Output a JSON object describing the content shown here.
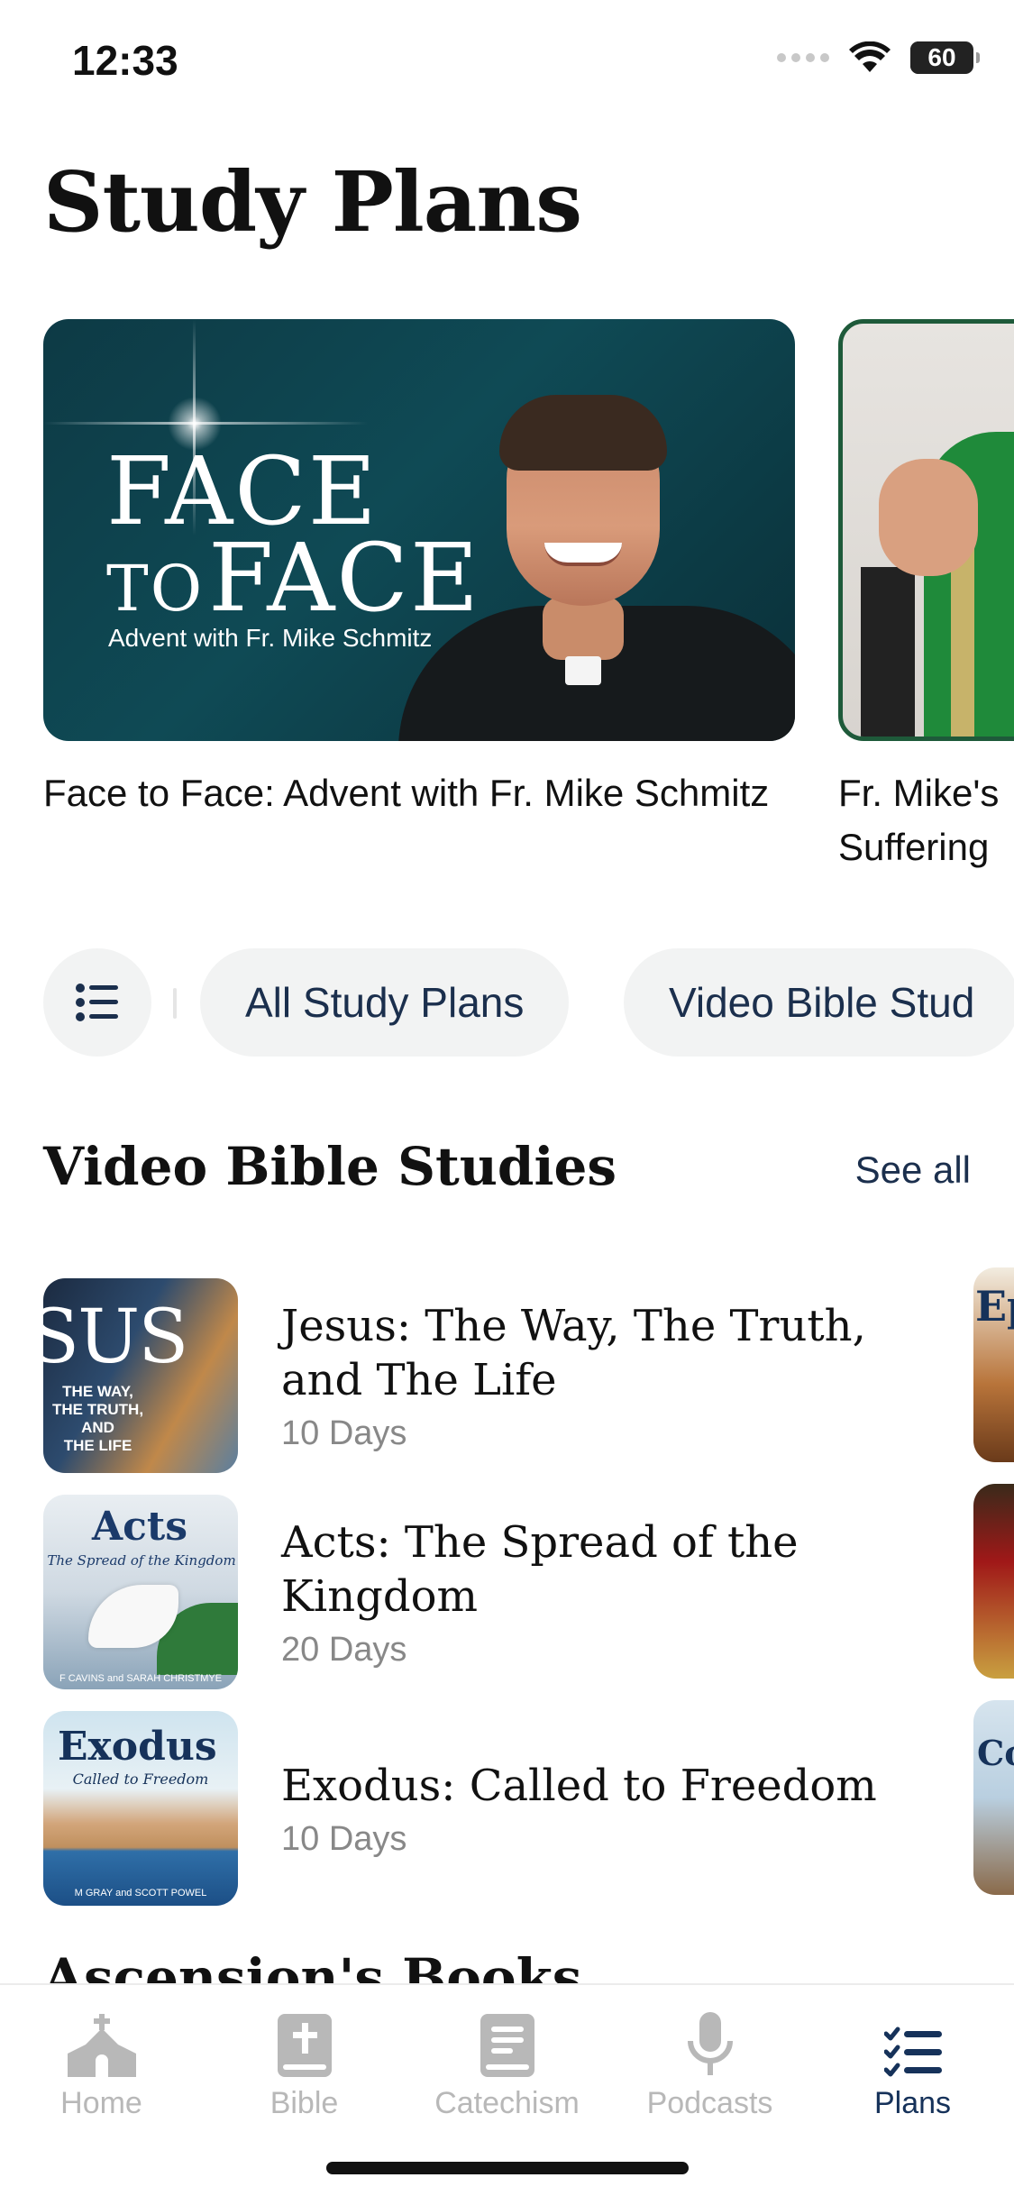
{
  "status_bar": {
    "time": "12:33",
    "battery_level": "60",
    "battery_fraction": 0.6
  },
  "header": {
    "title": "Study Plans"
  },
  "featured": [
    {
      "caption": "Face to Face: Advent with Fr. Mike Schmitz",
      "art_line1": "FACE",
      "art_to": "TO",
      "art_face": "FACE",
      "art_subtitle": "Advent with Fr. Mike Schmitz"
    },
    {
      "caption": "Fr. Mike's\nSuffering"
    }
  ],
  "filters": {
    "icon": "list-filter-icon",
    "pills": [
      "All Study Plans",
      "Video Bible Stud"
    ]
  },
  "section": {
    "title": "Video Bible Studies",
    "see_all": "See all",
    "items": [
      {
        "title": "Jesus: The Way, The Truth, and The Life",
        "days": "10 Days",
        "art_big": "SUS",
        "art_small": "THE WAY,\nTHE TRUTH,\nAND\nTHE LIFE"
      },
      {
        "title": "Acts: The Spread of the Kingdom",
        "days": "20 Days",
        "art_big": "Acts",
        "art_sub": "The Spread of the Kingdom",
        "art_authors": "F CAVINS and SARAH CHRISTMYE"
      },
      {
        "title": "Exodus: Called to Freedom",
        "days": "10 Days",
        "art_big": "Exodus",
        "art_sub": "Called to Freedom",
        "art_authors": "M GRAY and SCOTT POWEL"
      }
    ],
    "peek_labels": [
      "Ep",
      "",
      "Co"
    ]
  },
  "next_section": {
    "title": "Ascension's Books"
  },
  "tab_bar": {
    "tabs": [
      {
        "label": "Home",
        "icon": "church-icon"
      },
      {
        "label": "Bible",
        "icon": "bible-icon"
      },
      {
        "label": "Catechism",
        "icon": "book-icon"
      },
      {
        "label": "Podcasts",
        "icon": "microphone-icon"
      },
      {
        "label": "Plans",
        "icon": "checklist-icon"
      }
    ],
    "active": "Plans",
    "active_color": "#16325a",
    "inactive_color": "#b8b8b8"
  }
}
